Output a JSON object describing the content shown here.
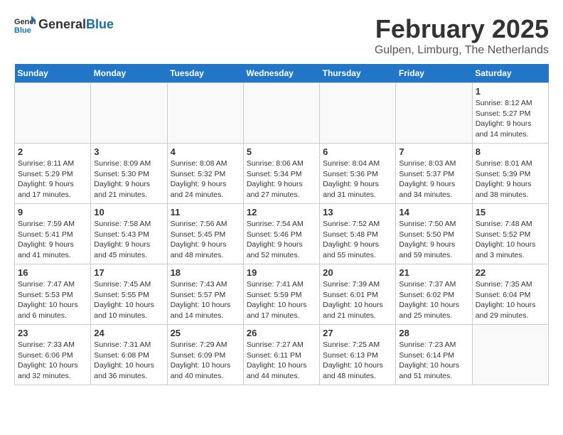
{
  "header": {
    "logo_general": "General",
    "logo_blue": "Blue",
    "title": "February 2025",
    "subtitle": "Gulpen, Limburg, The Netherlands"
  },
  "days_of_week": [
    "Sunday",
    "Monday",
    "Tuesday",
    "Wednesday",
    "Thursday",
    "Friday",
    "Saturday"
  ],
  "weeks": [
    [
      {
        "day": "",
        "info": ""
      },
      {
        "day": "",
        "info": ""
      },
      {
        "day": "",
        "info": ""
      },
      {
        "day": "",
        "info": ""
      },
      {
        "day": "",
        "info": ""
      },
      {
        "day": "",
        "info": ""
      },
      {
        "day": "1",
        "info": "Sunrise: 8:12 AM\nSunset: 5:27 PM\nDaylight: 9 hours and 14 minutes."
      }
    ],
    [
      {
        "day": "2",
        "info": "Sunrise: 8:11 AM\nSunset: 5:29 PM\nDaylight: 9 hours and 17 minutes."
      },
      {
        "day": "3",
        "info": "Sunrise: 8:09 AM\nSunset: 5:30 PM\nDaylight: 9 hours and 21 minutes."
      },
      {
        "day": "4",
        "info": "Sunrise: 8:08 AM\nSunset: 5:32 PM\nDaylight: 9 hours and 24 minutes."
      },
      {
        "day": "5",
        "info": "Sunrise: 8:06 AM\nSunset: 5:34 PM\nDaylight: 9 hours and 27 minutes."
      },
      {
        "day": "6",
        "info": "Sunrise: 8:04 AM\nSunset: 5:36 PM\nDaylight: 9 hours and 31 minutes."
      },
      {
        "day": "7",
        "info": "Sunrise: 8:03 AM\nSunset: 5:37 PM\nDaylight: 9 hours and 34 minutes."
      },
      {
        "day": "8",
        "info": "Sunrise: 8:01 AM\nSunset: 5:39 PM\nDaylight: 9 hours and 38 minutes."
      }
    ],
    [
      {
        "day": "9",
        "info": "Sunrise: 7:59 AM\nSunset: 5:41 PM\nDaylight: 9 hours and 41 minutes."
      },
      {
        "day": "10",
        "info": "Sunrise: 7:58 AM\nSunset: 5:43 PM\nDaylight: 9 hours and 45 minutes."
      },
      {
        "day": "11",
        "info": "Sunrise: 7:56 AM\nSunset: 5:45 PM\nDaylight: 9 hours and 48 minutes."
      },
      {
        "day": "12",
        "info": "Sunrise: 7:54 AM\nSunset: 5:46 PM\nDaylight: 9 hours and 52 minutes."
      },
      {
        "day": "13",
        "info": "Sunrise: 7:52 AM\nSunset: 5:48 PM\nDaylight: 9 hours and 55 minutes."
      },
      {
        "day": "14",
        "info": "Sunrise: 7:50 AM\nSunset: 5:50 PM\nDaylight: 9 hours and 59 minutes."
      },
      {
        "day": "15",
        "info": "Sunrise: 7:48 AM\nSunset: 5:52 PM\nDaylight: 10 hours and 3 minutes."
      }
    ],
    [
      {
        "day": "16",
        "info": "Sunrise: 7:47 AM\nSunset: 5:53 PM\nDaylight: 10 hours and 6 minutes."
      },
      {
        "day": "17",
        "info": "Sunrise: 7:45 AM\nSunset: 5:55 PM\nDaylight: 10 hours and 10 minutes."
      },
      {
        "day": "18",
        "info": "Sunrise: 7:43 AM\nSunset: 5:57 PM\nDaylight: 10 hours and 14 minutes."
      },
      {
        "day": "19",
        "info": "Sunrise: 7:41 AM\nSunset: 5:59 PM\nDaylight: 10 hours and 17 minutes."
      },
      {
        "day": "20",
        "info": "Sunrise: 7:39 AM\nSunset: 6:01 PM\nDaylight: 10 hours and 21 minutes."
      },
      {
        "day": "21",
        "info": "Sunrise: 7:37 AM\nSunset: 6:02 PM\nDaylight: 10 hours and 25 minutes."
      },
      {
        "day": "22",
        "info": "Sunrise: 7:35 AM\nSunset: 6:04 PM\nDaylight: 10 hours and 29 minutes."
      }
    ],
    [
      {
        "day": "23",
        "info": "Sunrise: 7:33 AM\nSunset: 6:06 PM\nDaylight: 10 hours and 32 minutes."
      },
      {
        "day": "24",
        "info": "Sunrise: 7:31 AM\nSunset: 6:08 PM\nDaylight: 10 hours and 36 minutes."
      },
      {
        "day": "25",
        "info": "Sunrise: 7:29 AM\nSunset: 6:09 PM\nDaylight: 10 hours and 40 minutes."
      },
      {
        "day": "26",
        "info": "Sunrise: 7:27 AM\nSunset: 6:11 PM\nDaylight: 10 hours and 44 minutes."
      },
      {
        "day": "27",
        "info": "Sunrise: 7:25 AM\nSunset: 6:13 PM\nDaylight: 10 hours and 48 minutes."
      },
      {
        "day": "28",
        "info": "Sunrise: 7:23 AM\nSunset: 6:14 PM\nDaylight: 10 hours and 51 minutes."
      },
      {
        "day": "",
        "info": ""
      }
    ]
  ]
}
